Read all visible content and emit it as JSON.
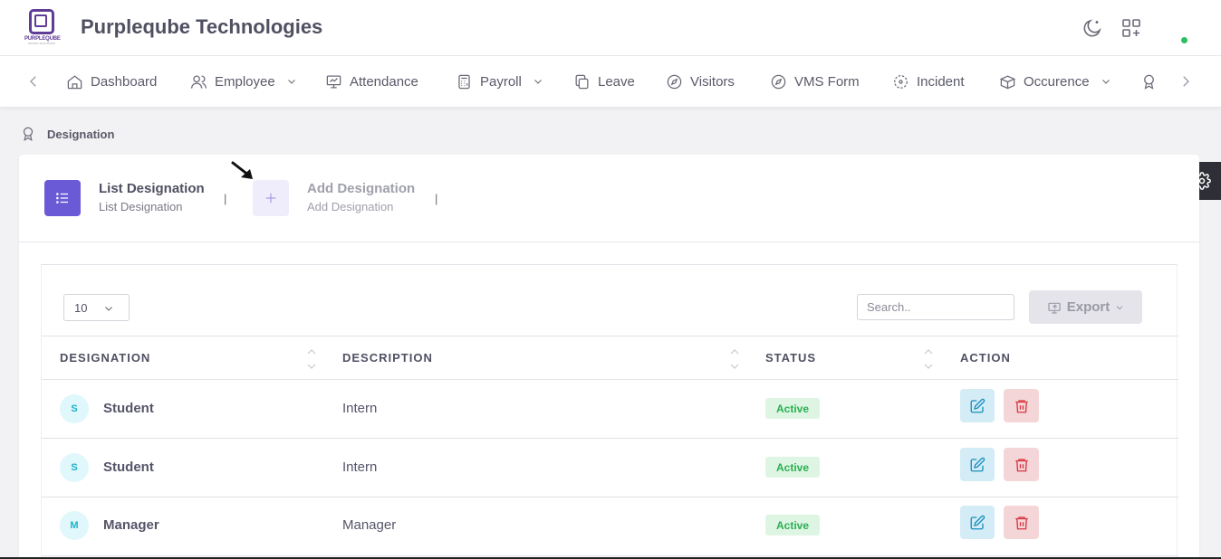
{
  "app": {
    "title": "Purpleqube Technologies",
    "logo_text": "PURPLEQUBE",
    "logo_sub": "DIGITAL SOLUTIONS"
  },
  "nav": {
    "items": [
      {
        "label": "Dashboard",
        "icon": "home-icon"
      },
      {
        "label": "Employee",
        "icon": "users-icon",
        "dropdown": true
      },
      {
        "label": "Attendance",
        "icon": "presentation-icon"
      },
      {
        "label": "Payroll",
        "icon": "calculator-icon",
        "dropdown": true
      },
      {
        "label": "Leave",
        "icon": "copy-icon"
      },
      {
        "label": "Visitors",
        "icon": "compass-icon"
      },
      {
        "label": "VMS Form",
        "icon": "compass-icon"
      },
      {
        "label": "Incident",
        "icon": "focus-icon"
      },
      {
        "label": "Occurence",
        "icon": "box-icon",
        "dropdown": true
      }
    ]
  },
  "breadcrumb": {
    "label": "Designation"
  },
  "tabs": [
    {
      "title": "List Designation",
      "subtitle": "List Designation",
      "active": true
    },
    {
      "title": "Add Designation",
      "subtitle": "Add Designation",
      "active": false
    }
  ],
  "table": {
    "page_size": "10",
    "search_placeholder": "Search..",
    "export_label": "Export",
    "columns": [
      "DESIGNATION",
      "DESCRIPTION",
      "STATUS",
      "ACTION"
    ],
    "rows": [
      {
        "initial": "S",
        "designation": "Student",
        "description": "Intern",
        "status": "Active"
      },
      {
        "initial": "S",
        "designation": "Student",
        "description": "Intern",
        "status": "Active"
      },
      {
        "initial": "M",
        "designation": "Manager",
        "description": "Manager",
        "status": "Active"
      }
    ]
  },
  "colors": {
    "accent": "#6b5ad6",
    "active_badge": "#28b050",
    "edit": "#1a8fc0",
    "delete": "#d8353f",
    "logo": "#5f3c95"
  }
}
